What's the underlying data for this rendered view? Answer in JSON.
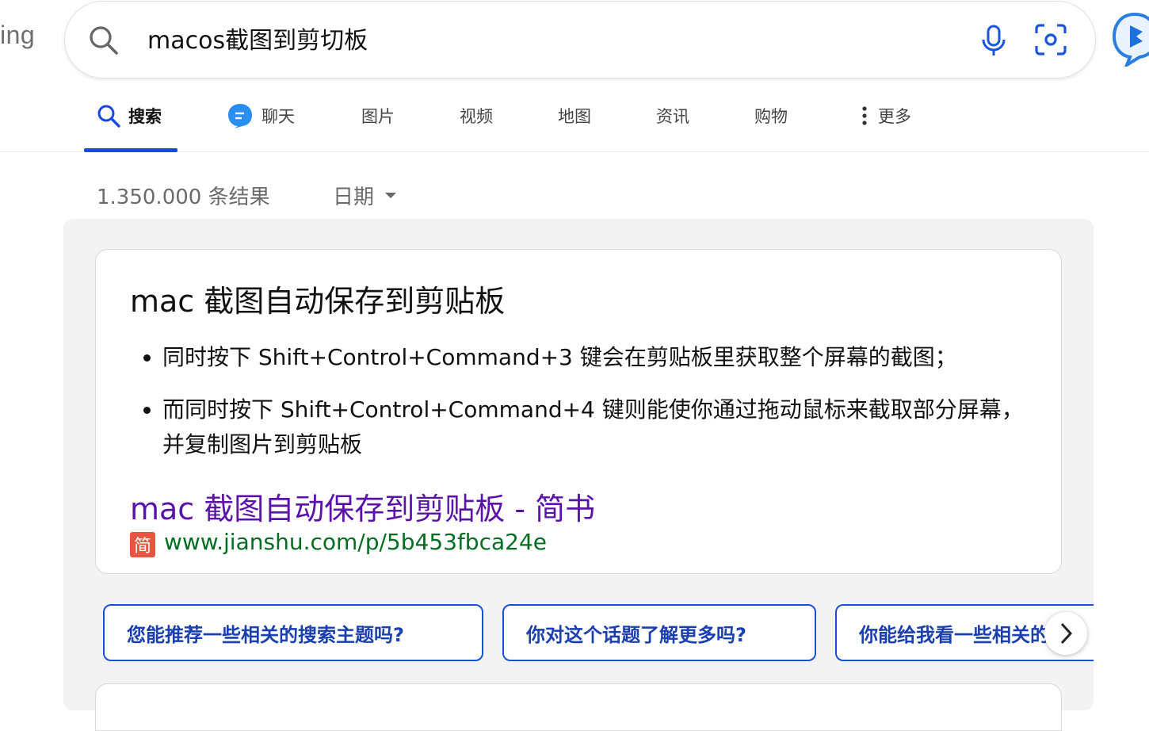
{
  "logo": {
    "fragment": "ing"
  },
  "search": {
    "query": "macos截图到剪切板"
  },
  "tabs": [
    {
      "label": "搜索"
    },
    {
      "label": "聊天"
    },
    {
      "label": "图片"
    },
    {
      "label": "视频"
    },
    {
      "label": "地图"
    },
    {
      "label": "资讯"
    },
    {
      "label": "购物"
    },
    {
      "label": "更多"
    }
  ],
  "results": {
    "count": "1.350.000 条结果",
    "date_filter": "日期"
  },
  "answer": {
    "title": "mac 截图自动保存到剪贴板",
    "bullets": [
      "同时按下 Shift+Control+Command+3 键会在剪贴板里获取整个屏幕的截图；",
      "而同时按下 Shift+Control+Command+4 键则能使你通过拖动鼠标来截取部分屏幕，并复制图片到剪贴板"
    ],
    "source_title": "mac 截图自动保存到剪贴板 - 简书",
    "favicon_char": "简",
    "source_url": "www.jianshu.com/p/5b453fbca24e"
  },
  "suggestions": [
    "您能推荐一些相关的搜索主题吗?",
    "你对这个话题了解更多吗?",
    "你能给我看一些相关的"
  ],
  "colors": {
    "accent": "#174ae4",
    "visited_link": "#5b12a8",
    "url_green": "#006d21"
  }
}
